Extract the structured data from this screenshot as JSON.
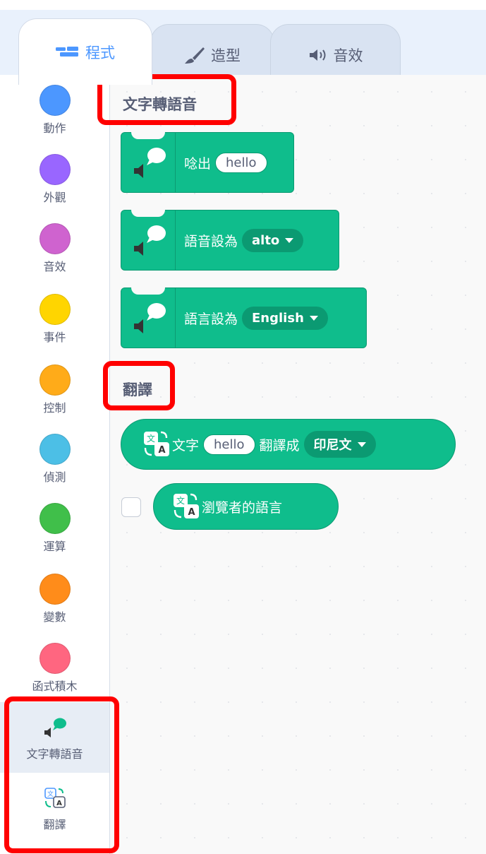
{
  "tabs": [
    {
      "label": "程式",
      "icon": "code-icon",
      "active": true
    },
    {
      "label": "造型",
      "icon": "brush-icon",
      "active": false
    },
    {
      "label": "音效",
      "icon": "speaker-icon",
      "active": false
    }
  ],
  "categories": [
    {
      "label": "動作",
      "color": "#4c97ff"
    },
    {
      "label": "外觀",
      "color": "#9966ff"
    },
    {
      "label": "音效",
      "color": "#cf63cf"
    },
    {
      "label": "事件",
      "color": "#ffd500"
    },
    {
      "label": "控制",
      "color": "#ffab19"
    },
    {
      "label": "偵測",
      "color": "#4cbfe6"
    },
    {
      "label": "運算",
      "color": "#40bf4a"
    },
    {
      "label": "變數",
      "color": "#ff8c1a"
    },
    {
      "label": "函式積木",
      "color": "#ff6680"
    },
    {
      "label": "文字轉語音",
      "icon": "text-to-speech-icon"
    },
    {
      "label": "翻譯",
      "icon": "translate-icon"
    }
  ],
  "tts": {
    "heading": "文字轉語音",
    "speak": {
      "label": "唸出",
      "value": "hello"
    },
    "voice": {
      "label": "語音設為",
      "value": "alto"
    },
    "language": {
      "label": "語言設為",
      "value": "English"
    }
  },
  "translate": {
    "heading": "翻譯",
    "translate_block": {
      "label1": "文字",
      "value": "hello",
      "label2": "翻譯成",
      "lang": "印尼文"
    },
    "viewer_language": {
      "label": "瀏覽者的語言"
    }
  },
  "colors": {
    "extension_green": "#0fbd8c",
    "highlight_red": "#ff0000",
    "active_tab_blue": "#4c97ff"
  }
}
